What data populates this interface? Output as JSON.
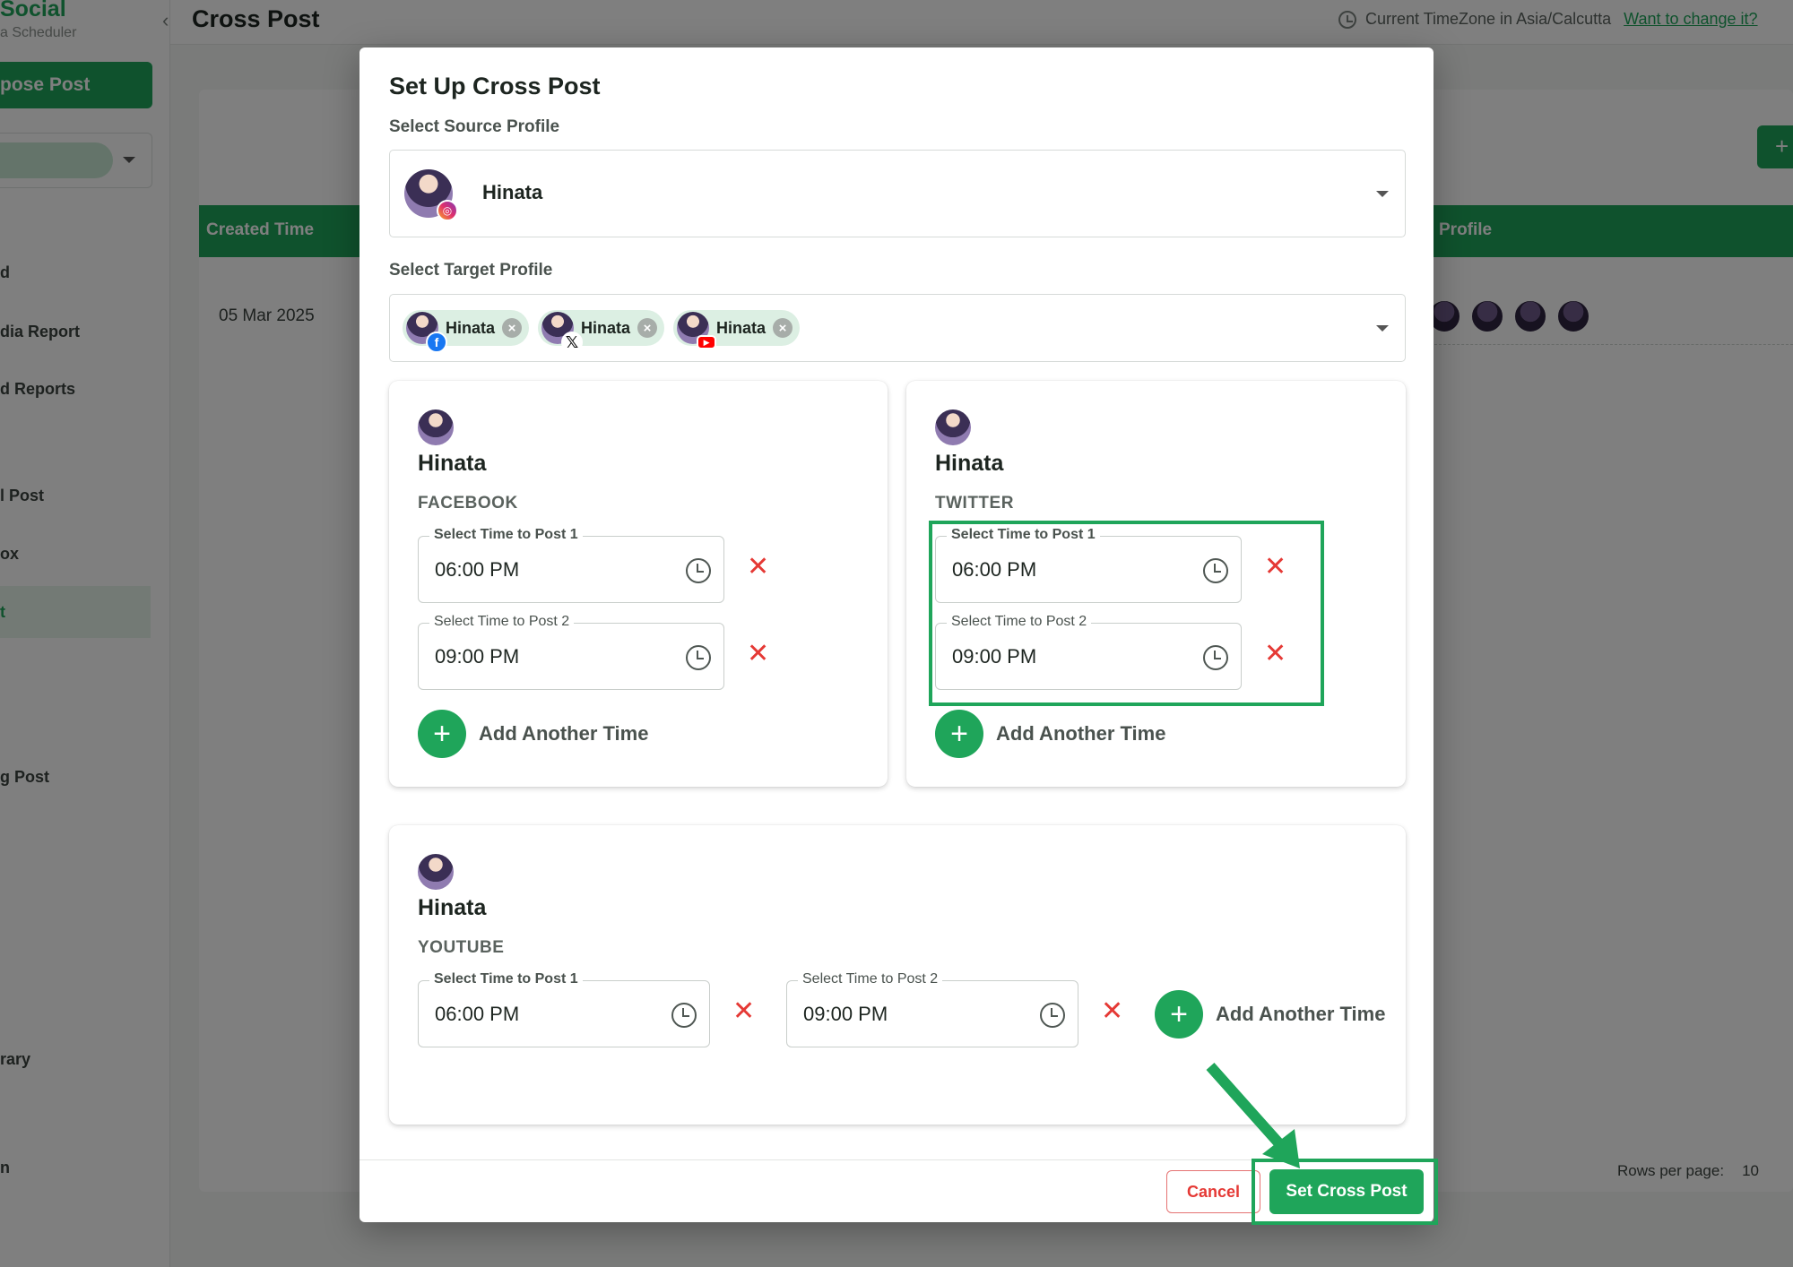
{
  "app": {
    "brand": "Social",
    "brand_sub": "a Scheduler",
    "compose_label": "pose Post",
    "page_title": "Cross Post",
    "timezone_text": "Current TimeZone in Asia/Calcutta",
    "timezone_link": "Want to change it?",
    "sidebar_items": [
      "d",
      "dia Report",
      "d Reports",
      "l Post",
      "ox",
      "t",
      "g Post",
      "rary",
      "n"
    ],
    "table_headers": {
      "created_time": "Created Time",
      "profile": "Profile"
    },
    "row_date": "05 Mar 2025",
    "add_icon": "+",
    "rows_per_page_label": "Rows per page:",
    "rows_per_page_value": "10"
  },
  "modal": {
    "title": "Set Up Cross Post",
    "source_label": "Select Source Profile",
    "source_profile": {
      "name": "Hinata",
      "platform_icon": "instagram-icon"
    },
    "target_label": "Select Target Profile",
    "target_chips": [
      {
        "name": "Hinata",
        "platform_icon": "facebook-icon",
        "remove_glyph": "×"
      },
      {
        "name": "Hinata",
        "platform_icon": "x-twitter-icon",
        "remove_glyph": "×"
      },
      {
        "name": "Hinata",
        "platform_icon": "youtube-icon",
        "remove_glyph": "×"
      }
    ],
    "cards": [
      {
        "name": "Hinata",
        "platform": "FACEBOOK",
        "times": [
          {
            "label": "Select Time to Post 1",
            "value": "06:00 PM"
          },
          {
            "label": "Select Time to Post 2",
            "value": "09:00 PM"
          }
        ],
        "add_label": "Add Another Time"
      },
      {
        "name": "Hinata",
        "platform": "TWITTER",
        "times": [
          {
            "label": "Select Time to Post 1",
            "value": "06:00 PM"
          },
          {
            "label": "Select Time to Post 2",
            "value": "09:00 PM"
          }
        ],
        "add_label": "Add Another Time"
      },
      {
        "name": "Hinata",
        "platform": "YOUTUBE",
        "times": [
          {
            "label": "Select Time to Post 1",
            "value": "06:00 PM"
          },
          {
            "label": "Select Time to Post 2",
            "value": "09:00 PM"
          }
        ],
        "add_label": "Add Another Time"
      }
    ],
    "remove_glyph": "✕",
    "add_glyph": "+",
    "cancel_label": "Cancel",
    "submit_label": "Set Cross Post"
  },
  "colors": {
    "accent": "#1fa55a",
    "danger": "#e53935",
    "overlay": "rgba(0,0,0,0.5)"
  }
}
